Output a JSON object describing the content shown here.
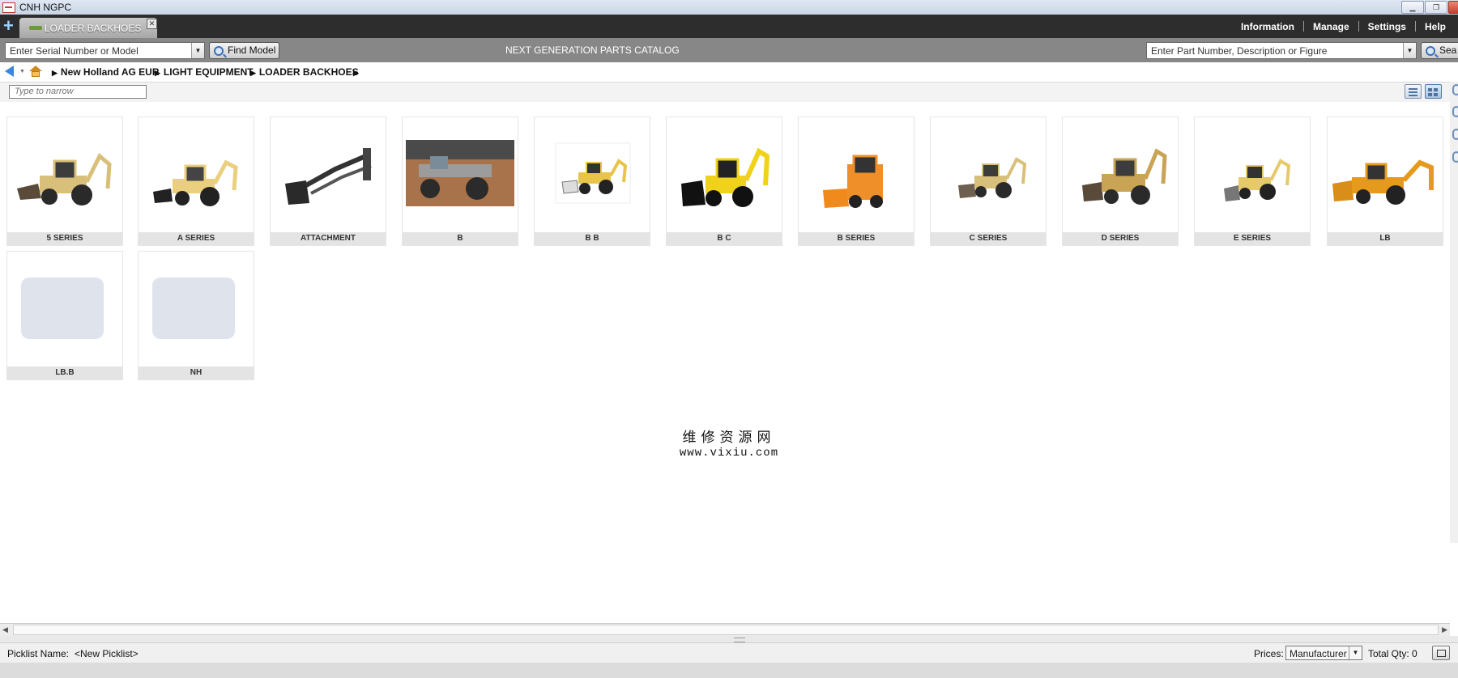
{
  "window": {
    "title": "CNH NGPC"
  },
  "tabs": [
    {
      "label": "LOADER BACKHOES"
    }
  ],
  "top_menu": [
    "Information",
    "Manage",
    "Settings",
    "Help"
  ],
  "search": {
    "serial_placeholder": "Enter Serial Number or Model",
    "find_model_label": "Find Model",
    "catalog_title": "NEXT GENERATION PARTS CATALOG",
    "part_placeholder": "Enter Part Number, Description or Figure",
    "search_label": "Sea"
  },
  "breadcrumb": [
    "New Holland AG EUR",
    "LIGHT EQUIPMENT",
    "LOADER BACKHOES"
  ],
  "filter": {
    "placeholder": "Type to narrow"
  },
  "models": [
    {
      "label": "5 SERIES"
    },
    {
      "label": "A SERIES"
    },
    {
      "label": "ATTACHMENT"
    },
    {
      "label": "B"
    },
    {
      "label": "B B"
    },
    {
      "label": "B C"
    },
    {
      "label": "B SERIES"
    },
    {
      "label": "C SERIES"
    },
    {
      "label": "D SERIES"
    },
    {
      "label": "E SERIES"
    },
    {
      "label": "LB"
    },
    {
      "label": "LB.B"
    },
    {
      "label": "NH"
    }
  ],
  "watermark": {
    "line1": "维修资源网",
    "line2": "www.vixiu.com"
  },
  "status": {
    "picklist_label": "Picklist Name:",
    "picklist_value": "<New Picklist>",
    "prices_label": "Prices:",
    "prices_value": "Manufacturer",
    "total_qty": "Total Qty: 0"
  },
  "colors": {
    "tabbar": "#2d2d2d",
    "searchbar": "#878787",
    "accent": "#3a86d9"
  }
}
